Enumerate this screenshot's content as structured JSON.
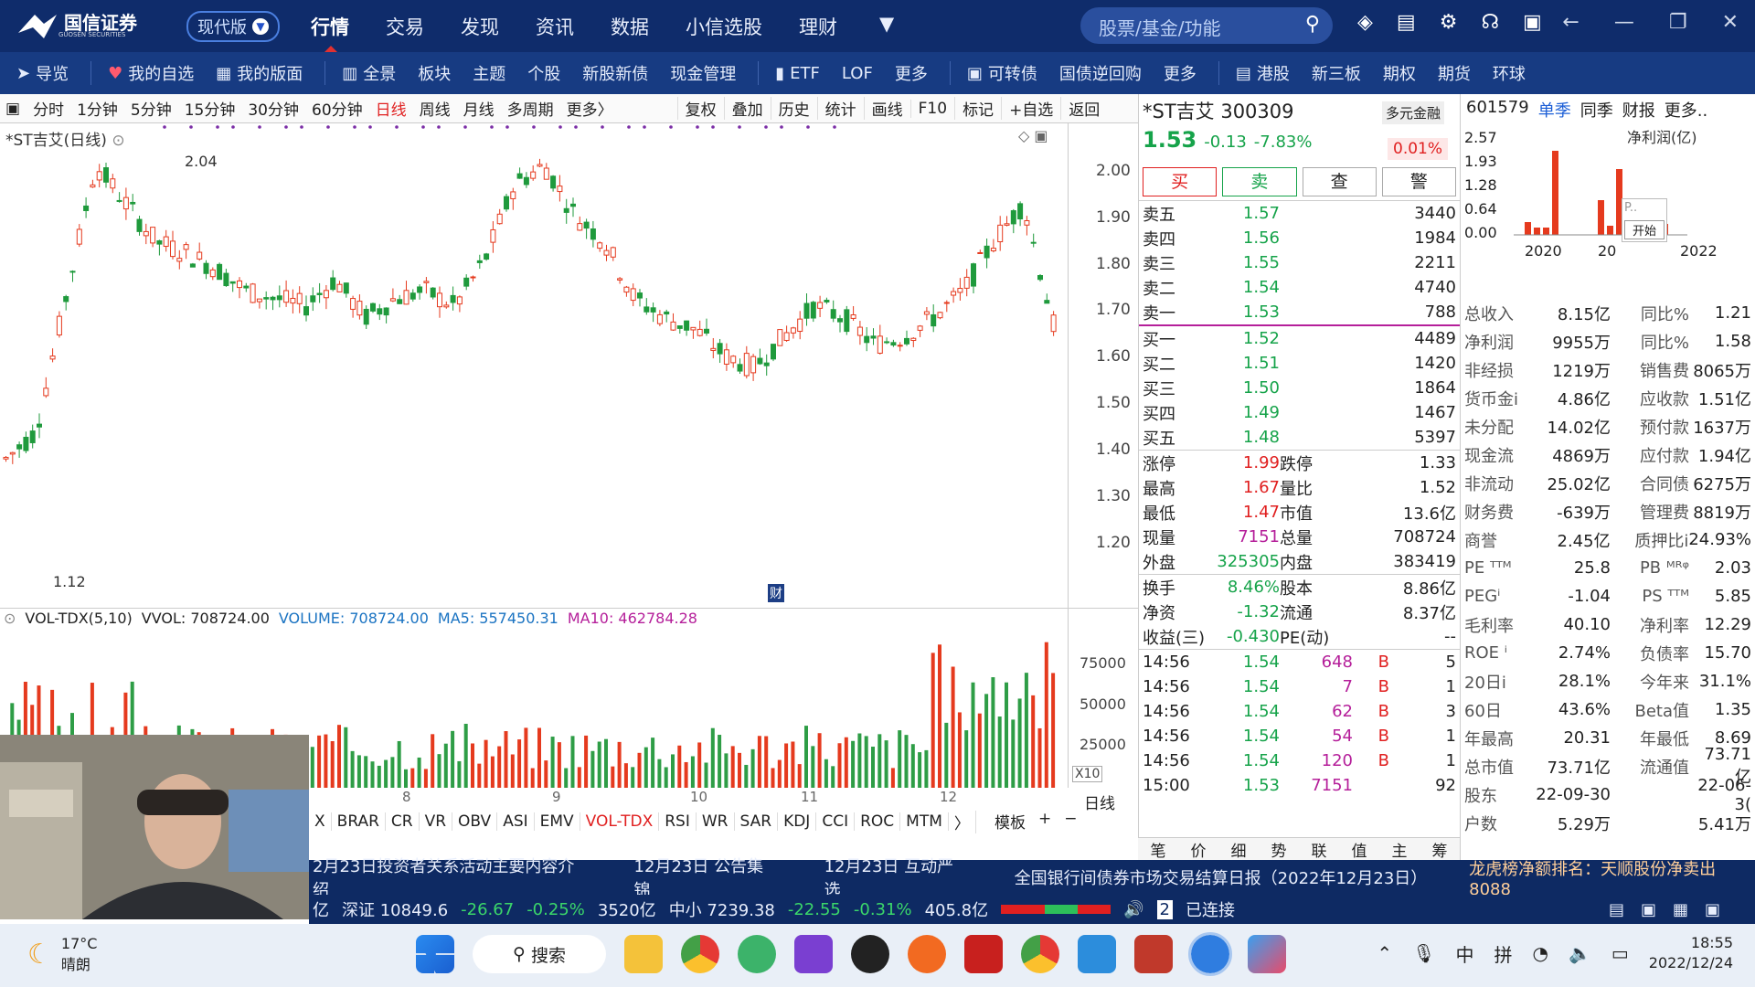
{
  "app": {
    "brand": "国信证券",
    "brand_sub": "GUOSEN SECURITIES",
    "mode": "现代版"
  },
  "main_nav": [
    "行情",
    "交易",
    "发现",
    "资讯",
    "数据",
    "小信选股",
    "理财"
  ],
  "search": {
    "placeholder": "股票/基金/功能"
  },
  "sub_nav": [
    "导览",
    "我的自选",
    "我的版面",
    "全景",
    "板块",
    "主题",
    "个股",
    "新股新债",
    "现金管理",
    "ETF",
    "LOF",
    "更多",
    "可转债",
    "国债逆回购",
    "更多",
    "港股",
    "新三板",
    "期权",
    "期货",
    "环球"
  ],
  "toolbar": {
    "periods": [
      "分时",
      "1分钟",
      "5分钟",
      "15分钟",
      "30分钟",
      "60分钟",
      "日线",
      "周线",
      "月线",
      "多周期",
      "更多〉"
    ],
    "actions": [
      "复权",
      "叠加",
      "历史",
      "统计",
      "画线",
      "F10",
      "标记",
      "+自选",
      "返回"
    ]
  },
  "chart": {
    "title": "*ST吉艾(日线)",
    "hi_label": "2.04",
    "lo_label": "1.12",
    "cai": "财",
    "price_ticks": [
      "2.00",
      "1.90",
      "1.80",
      "1.70",
      "1.60",
      "1.50",
      "1.40",
      "1.30",
      "1.20"
    ],
    "vol_header": {
      "name": "VOL-TDX(5,10)",
      "vvol": "VVOL: 708724.00",
      "volume": "VOLUME: 708724.00",
      "ma5": "MA5: 557450.31",
      "ma10": "MA10: 462784.28"
    },
    "vol_ticks": [
      "75000",
      "50000",
      "25000",
      "X10"
    ],
    "month_ticks": [
      "8",
      "9",
      "10",
      "11",
      "12"
    ],
    "period_tag": "日线"
  },
  "indicators": [
    "X",
    "BRAR",
    "CR",
    "VR",
    "OBV",
    "ASI",
    "EMV",
    "VOL-TDX",
    "RSI",
    "WR",
    "SAR",
    "KDJ",
    "CCI",
    "ROC",
    "MTM",
    "〉"
  ],
  "template_tabs": [
    "模板",
    "+",
    "−"
  ],
  "quote": {
    "name": "*ST吉艾 300309",
    "rz": "多元金融",
    "price": "1.53",
    "change": "-0.13",
    "pct": "-7.83%",
    "rate": "0.01%",
    "buttons": [
      "买",
      "卖",
      "查",
      "警"
    ],
    "asks": [
      [
        "卖五",
        "1.57",
        "3440"
      ],
      [
        "卖四",
        "1.56",
        "1984"
      ],
      [
        "卖三",
        "1.55",
        "2211"
      ],
      [
        "卖二",
        "1.54",
        "4740"
      ],
      [
        "卖一",
        "1.53",
        "788"
      ]
    ],
    "bids": [
      [
        "买一",
        "1.52",
        "4489"
      ],
      [
        "买二",
        "1.51",
        "1420"
      ],
      [
        "买三",
        "1.50",
        "1864"
      ],
      [
        "买四",
        "1.49",
        "1467"
      ],
      [
        "买五",
        "1.48",
        "5397"
      ]
    ],
    "stats": [
      [
        "涨停",
        "1.99",
        "跌停",
        "1.33"
      ],
      [
        "最高",
        "1.67",
        "量比",
        "1.52"
      ],
      [
        "最低",
        "1.47",
        "市值",
        "13.6亿"
      ],
      [
        "现量",
        "7151",
        "总量",
        "708724"
      ],
      [
        "外盘",
        "325305",
        "内盘",
        "383419"
      ]
    ],
    "stats2": [
      [
        "换手",
        "8.46%",
        "股本",
        "8.86亿"
      ],
      [
        "净资",
        "-1.32",
        "流通",
        "8.37亿"
      ],
      [
        "收益(三)",
        "-0.430",
        "PE(动)",
        "--"
      ]
    ],
    "ticks": [
      [
        "14:56",
        "1.54",
        "648",
        "B",
        "5"
      ],
      [
        "14:56",
        "1.54",
        "7",
        "B",
        "1"
      ],
      [
        "14:56",
        "1.54",
        "62",
        "B",
        "3"
      ],
      [
        "14:56",
        "1.54",
        "54",
        "B",
        "1"
      ],
      [
        "14:56",
        "1.54",
        "120",
        "B",
        "1"
      ],
      [
        "15:00",
        "1.53",
        "7151",
        "",
        "92"
      ]
    ],
    "bottom_tabs": [
      "笔",
      "价",
      "细",
      "势",
      "联",
      "值",
      "主",
      "筹"
    ]
  },
  "fin": {
    "code": "601579",
    "tabs": [
      "单季",
      "同季",
      "财报",
      "更多.."
    ],
    "chart_label": "净利润(亿)",
    "y_ticks": [
      "2.57",
      "1.93",
      "1.28",
      "0.64",
      "0.00"
    ],
    "x_ticks": [
      "2020",
      "20",
      "2022"
    ],
    "popup": "P..",
    "popup_btn": "开始",
    "rows": [
      [
        "总收入",
        "8.15亿",
        "同比%",
        "1.21"
      ],
      [
        "净利润",
        "9955万",
        "同比%",
        "1.58"
      ],
      [
        "非经损",
        "1219万",
        "销售费",
        "8065万"
      ],
      [
        "货币金i",
        "4.86亿",
        "应收款",
        "1.51亿"
      ],
      [
        "未分配",
        "14.02亿",
        "预付款",
        "1637万"
      ],
      [
        "现金流",
        "4869万",
        "应付款",
        "1.94亿"
      ],
      [
        "非流动",
        "25.02亿",
        "合同债",
        "6275万"
      ],
      [
        "财务费",
        "-639万",
        "管理费",
        "8819万"
      ],
      [
        "商誉",
        "2.45亿",
        "质押比i",
        "24.93%"
      ],
      [
        "PE ᵀᵀᴹ",
        "25.8",
        "PB ᴹᴿᵠ",
        "2.03"
      ],
      [
        "PEGⁱ",
        "-1.04",
        "PS ᵀᵀᴹ",
        "5.85"
      ],
      [
        "毛利率",
        "40.10",
        "净利率",
        "12.29"
      ],
      [
        "ROE ⁱ",
        "2.74%",
        "负债率",
        "15.70"
      ],
      [
        "20日i",
        "28.1%",
        "今年来",
        "31.1%"
      ],
      [
        "60日",
        "43.6%",
        "Beta值",
        "1.35"
      ],
      [
        "年最高",
        "20.31",
        "年最低",
        "8.69"
      ],
      [
        "总市值",
        "73.71亿",
        "流通值",
        "73.71亿"
      ],
      [
        "股东",
        "22-09-30",
        "",
        "22-06-3("
      ],
      [
        "户数",
        "5.29万",
        "",
        "5.41万"
      ]
    ]
  },
  "news": [
    "2月23日投资者关系活动主要内容介绍",
    "12月23日 公告集锦",
    "12月23日 互动严选",
    "全国银行间债券市场交易结算日报（2022年12月23日）",
    "龙虎榜净额排名：天顺股份净卖出8088"
  ],
  "status": {
    "items": [
      "亿",
      "深证 10849.6",
      "-26.67",
      "-0.25%",
      "3520亿",
      "中小 7239.38",
      "-22.55",
      "-0.31%",
      "405.8亿"
    ],
    "conn": "已连接",
    "conn_num": "2"
  },
  "taskbar": {
    "temp": "17°C",
    "weather": "晴朗",
    "search": "搜索",
    "ime1": "中",
    "ime2": "拼",
    "time": "18:55",
    "date": "2022/12/24"
  },
  "chart_data": {
    "type": "candlestick",
    "title": "*ST吉艾(日线)",
    "ylim": [
      1.12,
      2.04
    ],
    "hi": 2.04,
    "lo": 1.12,
    "last": 1.53,
    "volume": 708724,
    "ma5": 557450.31,
    "ma10": 462784.28
  }
}
